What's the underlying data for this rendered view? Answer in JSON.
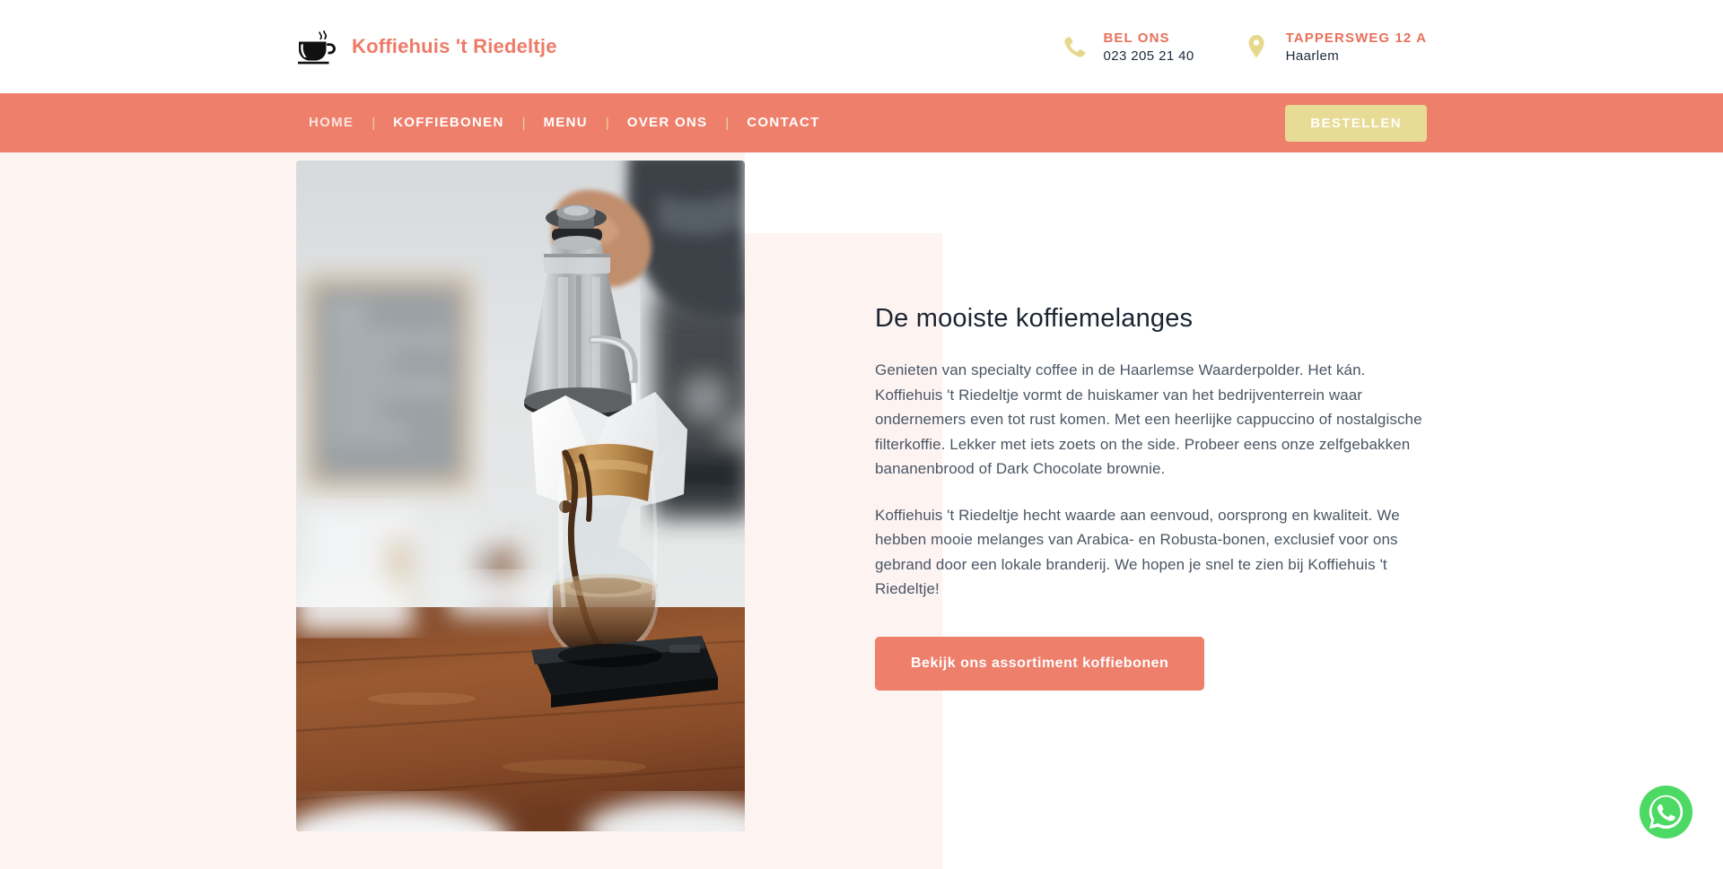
{
  "site": {
    "brand_name": "Koffiehuis 't Riedeltje",
    "brand_color": "#EE7B68",
    "nav_bar_color": "#EE7F6B",
    "accent_yellow": "#E8DB95",
    "page_bg": "#FDF4F2",
    "logo_icon": "coffee-cup-icon"
  },
  "header": {
    "phone": {
      "icon": "phone-icon",
      "label": "BEL ONS",
      "value": "023 205 21 40"
    },
    "address": {
      "icon": "map-pin-icon",
      "label": "TAPPERSWEG 12 A",
      "value": "Haarlem"
    }
  },
  "nav": {
    "items": [
      {
        "label": "HOME",
        "active": true
      },
      {
        "label": "KOFFIEBONEN",
        "active": false
      },
      {
        "label": "MENU",
        "active": false
      },
      {
        "label": "OVER ONS",
        "active": false
      },
      {
        "label": "CONTACT",
        "active": false
      }
    ],
    "separator": "|",
    "order_button": "BESTELLEN"
  },
  "main": {
    "image_alt": "Barista giet water uit een gooseneck waterkoker in een Chemex filterkoffiezetter op een weegschaal, op een houten tafel",
    "title": "De mooiste koffiemelanges",
    "paragraph_1": "Genieten van specialty coffee in de Haarlemse Waarderpolder. Het kán. Koffiehuis 't Riedeltje vormt de huiskamer van het bedrijventerrein waar ondernemers even tot rust komen. Met een heerlijke cappuccino of nostalgische filterkoffie. Lekker met iets zoets on the side. Probeer eens onze zelfgebakken bananenbrood of Dark Chocolate brownie.",
    "paragraph_2": "Koffiehuis 't Riedeltje hecht waarde aan eenvoud, oorsprong en kwaliteit. We hebben mooie melanges van Arabica- en Robusta-bonen, exclusief voor ons gebrand door een lokale branderij. We hopen je snel te zien bij Koffiehuis 't Riedeltje!",
    "cta_button": "Bekijk ons assortiment koffiebonen"
  },
  "floating": {
    "whatsapp_icon": "whatsapp-icon",
    "whatsapp_color": "#4CD964"
  }
}
